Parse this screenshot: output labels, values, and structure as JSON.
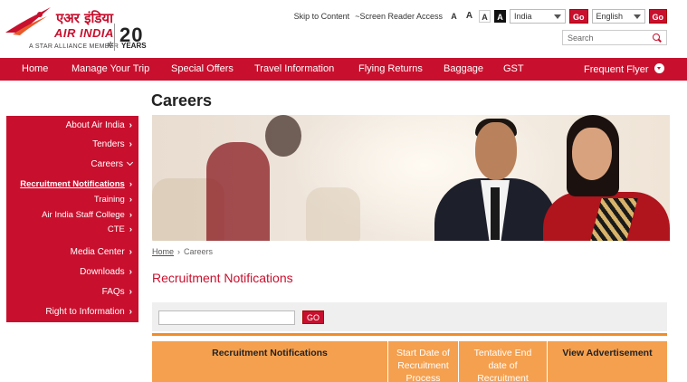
{
  "header": {
    "logo_hindi": "एअर इंडिया",
    "logo_name": "AIR INDIA",
    "logo_tagline": "A STAR ALLIANCE MEMBER",
    "anniversary_number": "20",
    "anniversary_word": "YEARS",
    "skip_link": "Skip to Content",
    "screen_reader_link": "~Screen Reader Access",
    "font_small": "A",
    "font_medium": "A",
    "font_large": "A",
    "font_contrast": "A",
    "country_select": "India",
    "country_go": "Go",
    "language_select": "English",
    "language_go": "Go",
    "search_placeholder": "Search"
  },
  "nav": {
    "items": [
      {
        "label": "Home"
      },
      {
        "label": "Manage Your Trip"
      },
      {
        "label": "Special Offers"
      },
      {
        "label": "Travel Information"
      },
      {
        "label": "Flying Returns"
      },
      {
        "label": "Baggage"
      },
      {
        "label": "GST"
      }
    ],
    "frequent_flyer": "Frequent Flyer"
  },
  "page": {
    "title": "Careers",
    "breadcrumb_home": "Home",
    "breadcrumb_current": "Careers",
    "section_title": "Recruitment Notifications",
    "filter_go": "GO"
  },
  "sidebar": {
    "items": [
      {
        "label": "About Air India"
      },
      {
        "label": "Tenders"
      },
      {
        "label": "Careers"
      },
      {
        "label": "Recruitment Notifications"
      },
      {
        "label": "Training"
      },
      {
        "label": "Air India Staff College"
      },
      {
        "label": "CTE"
      },
      {
        "label": "Media Center"
      },
      {
        "label": "Downloads"
      },
      {
        "label": "FAQs"
      },
      {
        "label": "Right to Information"
      }
    ]
  },
  "table": {
    "columns": [
      "Recruitment Notifications",
      "Start Date of Recruitment Process",
      "Tentative End date of Recruitment",
      "View Advertisement"
    ]
  },
  "colors": {
    "brand_red": "#c8102e",
    "table_orange": "#f4a04f"
  }
}
